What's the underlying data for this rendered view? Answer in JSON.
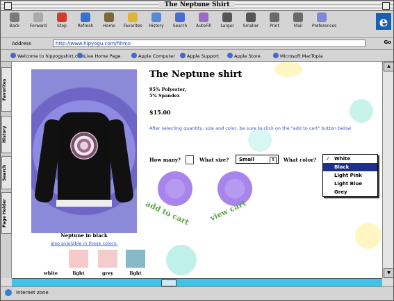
{
  "window": {
    "title": "The Neptune Shirt"
  },
  "toolbar": {
    "buttons": [
      {
        "label": "Back",
        "icon": "back-arrow-icon"
      },
      {
        "label": "Forward",
        "icon": "forward-arrow-icon"
      },
      {
        "label": "Stop",
        "icon": "stop-icon"
      },
      {
        "label": "Refresh",
        "icon": "refresh-icon"
      },
      {
        "label": "Home",
        "icon": "home-icon"
      },
      {
        "label": "Favorites",
        "icon": "favorites-icon"
      },
      {
        "label": "History",
        "icon": "history-icon"
      },
      {
        "label": "Search",
        "icon": "search-icon"
      },
      {
        "label": "AutoFill",
        "icon": "autofill-icon"
      },
      {
        "label": "Larger",
        "icon": "larger-text-icon"
      },
      {
        "label": "Smaller",
        "icon": "smaller-text-icon"
      },
      {
        "label": "Print",
        "icon": "print-icon"
      },
      {
        "label": "Mail",
        "icon": "mail-icon"
      },
      {
        "label": "Preferences",
        "icon": "preferences-icon"
      }
    ]
  },
  "address": {
    "label": "Address",
    "url": "http://www.hipyogu.com/filtmo",
    "go": "Go"
  },
  "favorites": [
    "Welcome to hipyogyshirt.com",
    "Live Home Page",
    "Apple Computer",
    "Apple Support",
    "Apple Store",
    "Microsoft MacTopia"
  ],
  "sidetabs": [
    "Favorites",
    "History",
    "Search",
    "Page Holder"
  ],
  "product": {
    "title": "The Neptune shirt",
    "material_1": "95% Polyester,",
    "material_2": "5% Spandex",
    "price": "$15.00",
    "instructions": "After selecting quantity, size and color, be sure to click on the \"add to cart\" button below",
    "image_caption": "Neptune in black",
    "available_link": "also available in these colors:",
    "swatches": [
      {
        "name": "white",
        "color": "#ffffff"
      },
      {
        "name": "light",
        "color": "#f7c9c9"
      },
      {
        "name": "grey",
        "color": "#f3cdcd"
      },
      {
        "name": "light",
        "color": "#86bac6"
      }
    ]
  },
  "order": {
    "qty_label": "How many?",
    "size_label": "What size?",
    "size_value": "Small",
    "color_label": "What color?",
    "color_options": [
      "White",
      "Black",
      "Light Pink",
      "Light Blue",
      "Grey"
    ],
    "color_checked": "White",
    "color_highlighted": "Black"
  },
  "buttons": {
    "add_to_cart": "add to cart",
    "view_cart": "view cart"
  },
  "status": {
    "zone": "Internet zone"
  },
  "colors": {
    "accent_scroll": "#3fc3ea",
    "link": "#3a5bd6",
    "cart_text": "#5ca646",
    "flower_purple": "#a785ec"
  }
}
